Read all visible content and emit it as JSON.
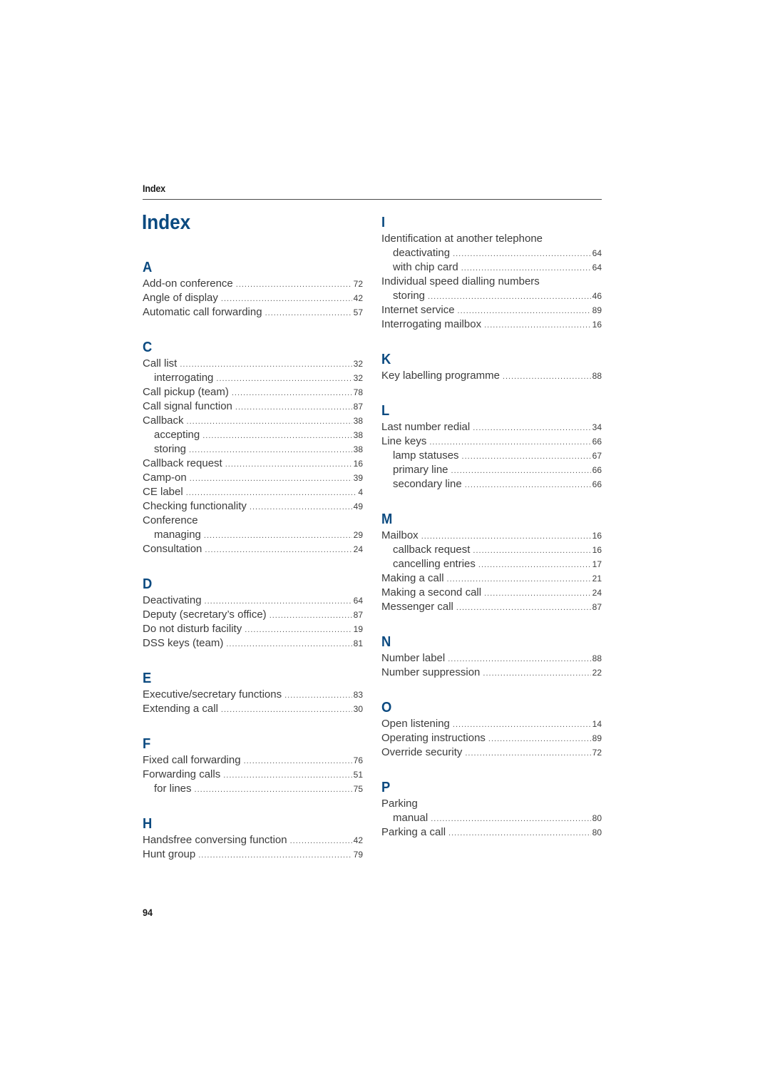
{
  "running_head": "Index",
  "title": "Index",
  "folio": "94",
  "left_column": [
    {
      "letter": "A",
      "entries": [
        {
          "term": "Add-on conference",
          "page": "72",
          "level": 0
        },
        {
          "term": "Angle of display",
          "page": "42",
          "level": 0
        },
        {
          "term": "Automatic call forwarding",
          "page": "57",
          "level": 0
        }
      ]
    },
    {
      "letter": "C",
      "entries": [
        {
          "term": "Call list",
          "page": "32",
          "level": 0
        },
        {
          "term": "interrogating",
          "page": "32",
          "level": 1
        },
        {
          "term": "Call pickup (team)",
          "page": "78",
          "level": 0
        },
        {
          "term": "Call signal function",
          "page": "87",
          "level": 0
        },
        {
          "term": "Callback",
          "page": "38",
          "level": 0
        },
        {
          "term": "accepting",
          "page": "38",
          "level": 1
        },
        {
          "term": "storing",
          "page": "38",
          "level": 1
        },
        {
          "term": "Callback request",
          "page": "16",
          "level": 0
        },
        {
          "term": "Camp-on",
          "page": "39",
          "level": 0
        },
        {
          "term": "CE label",
          "page": "4",
          "level": 0
        },
        {
          "term": "Checking functionality",
          "page": "49",
          "level": 0
        },
        {
          "term": "Conference",
          "page": "",
          "level": 0
        },
        {
          "term": "managing",
          "page": "29",
          "level": 1
        },
        {
          "term": "Consultation",
          "page": "24",
          "level": 0
        }
      ]
    },
    {
      "letter": "D",
      "entries": [
        {
          "term": "Deactivating",
          "page": "64",
          "level": 0
        },
        {
          "term": "Deputy (secretary’s office)",
          "page": "87",
          "level": 0
        },
        {
          "term": "Do not disturb facility",
          "page": "19",
          "level": 0
        },
        {
          "term": "DSS keys (team)",
          "page": "81",
          "level": 0
        }
      ]
    },
    {
      "letter": "E",
      "entries": [
        {
          "term": "Executive/secretary functions",
          "page": "83",
          "level": 0
        },
        {
          "term": "Extending a call",
          "page": "30",
          "level": 0
        }
      ]
    },
    {
      "letter": "F",
      "entries": [
        {
          "term": "Fixed call forwarding",
          "page": "76",
          "level": 0
        },
        {
          "term": "Forwarding calls",
          "page": "51",
          "level": 0
        },
        {
          "term": "for lines",
          "page": "75",
          "level": 1
        }
      ]
    },
    {
      "letter": "H",
      "entries": [
        {
          "term": "Handsfree conversing function",
          "page": "42",
          "level": 0
        },
        {
          "term": "Hunt group",
          "page": "79",
          "level": 0
        }
      ]
    }
  ],
  "right_column": [
    {
      "letter": "I",
      "entries": [
        {
          "term": "Identification at another telephone",
          "page": "",
          "level": 0
        },
        {
          "term": "deactivating",
          "page": "64",
          "level": 1
        },
        {
          "term": "with chip card",
          "page": "64",
          "level": 1
        },
        {
          "term": "Individual speed dialling numbers",
          "page": "",
          "level": 0
        },
        {
          "term": "storing",
          "page": "46",
          "level": 1
        },
        {
          "term": "Internet service",
          "page": "89",
          "level": 0
        },
        {
          "term": "Interrogating mailbox",
          "page": "16",
          "level": 0
        }
      ]
    },
    {
      "letter": "K",
      "entries": [
        {
          "term": "Key labelling programme",
          "page": "88",
          "level": 0
        }
      ]
    },
    {
      "letter": "L",
      "entries": [
        {
          "term": "Last number redial",
          "page": "34",
          "level": 0
        },
        {
          "term": "Line keys",
          "page": "66",
          "level": 0
        },
        {
          "term": "lamp statuses",
          "page": "67",
          "level": 1
        },
        {
          "term": "primary line",
          "page": "66",
          "level": 1
        },
        {
          "term": "secondary line",
          "page": "66",
          "level": 1
        }
      ]
    },
    {
      "letter": "M",
      "entries": [
        {
          "term": "Mailbox",
          "page": "16",
          "level": 0
        },
        {
          "term": "callback request",
          "page": "16",
          "level": 1
        },
        {
          "term": "cancelling entries",
          "page": "17",
          "level": 1
        },
        {
          "term": "Making a call",
          "page": "21",
          "level": 0
        },
        {
          "term": "Making a second call",
          "page": "24",
          "level": 0
        },
        {
          "term": "Messenger call",
          "page": "87",
          "level": 0
        }
      ]
    },
    {
      "letter": "N",
      "entries": [
        {
          "term": "Number label",
          "page": "88",
          "level": 0
        },
        {
          "term": "Number suppression",
          "page": "22",
          "level": 0
        }
      ]
    },
    {
      "letter": "O",
      "entries": [
        {
          "term": "Open listening",
          "page": "14",
          "level": 0
        },
        {
          "term": "Operating instructions",
          "page": "89",
          "level": 0
        },
        {
          "term": "Override security",
          "page": "72",
          "level": 0
        }
      ]
    },
    {
      "letter": "P",
      "entries": [
        {
          "term": "Parking",
          "page": "",
          "level": 0
        },
        {
          "term": "manual",
          "page": "80",
          "level": 1
        },
        {
          "term": "Parking a call",
          "page": "80",
          "level": 0
        }
      ]
    }
  ]
}
